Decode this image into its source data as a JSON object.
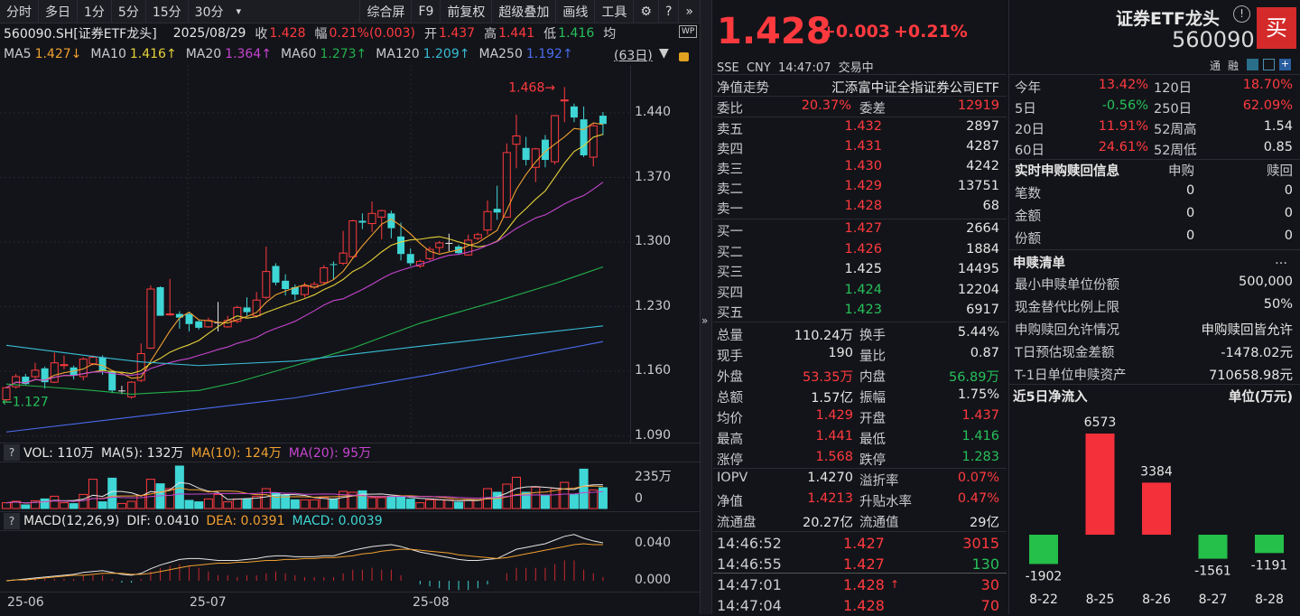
{
  "toolbar": {
    "items": [
      "分时",
      "多日",
      "1分",
      "5分",
      "15分",
      "30分"
    ],
    "more": "▾",
    "right_items": [
      "综合屏",
      "F9",
      "前复权",
      "超级叠加",
      "画线",
      "工具"
    ]
  },
  "info": {
    "code_name": "560090.SH[证券ETF龙头]",
    "date": "2025/08/29",
    "close_label": "收",
    "close": "1.428",
    "amp_label": "幅",
    "amp": "0.21%(0.003)",
    "open_label": "开",
    "open": "1.437",
    "high_label": "高",
    "high": "1.441",
    "low_label": "低",
    "low": "1.416",
    "avg_label": "均",
    "wp": "WP"
  },
  "ma": [
    {
      "label": "MA5",
      "value": "1.427↓",
      "color": "#f0a030"
    },
    {
      "label": "MA10",
      "value": "1.416↑",
      "color": "#e6d23a"
    },
    {
      "label": "MA20",
      "value": "1.364↑",
      "color": "#c545cf"
    },
    {
      "label": "MA60",
      "value": "1.273↑",
      "color": "#22b14c"
    },
    {
      "label": "MA120",
      "value": "1.209↑",
      "color": "#39bdd6"
    },
    {
      "label": "MA250",
      "value": "1.192↑",
      "color": "#4a6cf0"
    }
  ],
  "period": "(63日)",
  "colors": {
    "up": "#ff3a3f",
    "down": "#3fd6d6",
    "flat": "#e6e6e6",
    "bg": "#131419"
  },
  "chart_data": [
    {
      "type": "candlestick",
      "title": "",
      "ylim": [
        1.09,
        1.47
      ],
      "y_ticks": [
        "1.440",
        "1.370",
        "1.300",
        "1.230",
        "1.160",
        "1.090"
      ],
      "x_ticks": [
        "25-06",
        "25-07",
        "25-08"
      ],
      "high_mark": "1.468",
      "low_mark": "1.127",
      "ohlc": [
        [
          1.129,
          1.143,
          1.127,
          1.142
        ],
        [
          1.143,
          1.157,
          1.141,
          1.154
        ],
        [
          1.154,
          1.157,
          1.145,
          1.146
        ],
        [
          1.154,
          1.169,
          1.152,
          1.161
        ],
        [
          1.163,
          1.165,
          1.141,
          1.148
        ],
        [
          1.148,
          1.18,
          1.147,
          1.169
        ],
        [
          1.166,
          1.177,
          1.162,
          1.167
        ],
        [
          1.164,
          1.166,
          1.151,
          1.155
        ],
        [
          1.154,
          1.175,
          1.15,
          1.173
        ],
        [
          1.168,
          1.177,
          1.166,
          1.175
        ],
        [
          1.175,
          1.177,
          1.156,
          1.161
        ],
        [
          1.16,
          1.161,
          1.136,
          1.139
        ],
        [
          1.139,
          1.144,
          1.135,
          1.139
        ],
        [
          1.132,
          1.149,
          1.13,
          1.148
        ],
        [
          1.15,
          1.19,
          1.148,
          1.179
        ],
        [
          1.185,
          1.253,
          1.184,
          1.249
        ],
        [
          1.251,
          1.252,
          1.22,
          1.22
        ],
        [
          1.221,
          1.26,
          1.22,
          1.222
        ],
        [
          1.222,
          1.225,
          1.206,
          1.218
        ],
        [
          1.222,
          1.223,
          1.203,
          1.211
        ],
        [
          1.214,
          1.216,
          1.205,
          1.207
        ],
        [
          1.208,
          1.218,
          1.207,
          1.215
        ],
        [
          1.213,
          1.235,
          1.203,
          1.213
        ],
        [
          1.208,
          1.22,
          1.207,
          1.215
        ],
        [
          1.214,
          1.231,
          1.212,
          1.229
        ],
        [
          1.229,
          1.24,
          1.22,
          1.224
        ],
        [
          1.22,
          1.246,
          1.218,
          1.237
        ],
        [
          1.24,
          1.295,
          1.238,
          1.268
        ],
        [
          1.274,
          1.277,
          1.253,
          1.256
        ],
        [
          1.258,
          1.265,
          1.242,
          1.249
        ],
        [
          1.251,
          1.254,
          1.237,
          1.243
        ],
        [
          1.243,
          1.256,
          1.24,
          1.252
        ],
        [
          1.251,
          1.257,
          1.249,
          1.254
        ],
        [
          1.256,
          1.275,
          1.254,
          1.272
        ],
        [
          1.276,
          1.279,
          1.259,
          1.275
        ],
        [
          1.277,
          1.312,
          1.275,
          1.288
        ],
        [
          1.284,
          1.324,
          1.282,
          1.323
        ],
        [
          1.323,
          1.331,
          1.314,
          1.321
        ],
        [
          1.32,
          1.344,
          1.311,
          1.331
        ],
        [
          1.327,
          1.335,
          1.303,
          1.334
        ],
        [
          1.331,
          1.334,
          1.304,
          1.315
        ],
        [
          1.306,
          1.321,
          1.28,
          1.287
        ],
        [
          1.287,
          1.293,
          1.274,
          1.277
        ],
        [
          1.274,
          1.281,
          1.272,
          1.279
        ],
        [
          1.282,
          1.295,
          1.28,
          1.292
        ],
        [
          1.294,
          1.301,
          1.288,
          1.299
        ],
        [
          1.299,
          1.309,
          1.29,
          1.299
        ],
        [
          1.295,
          1.297,
          1.286,
          1.288
        ],
        [
          1.286,
          1.308,
          1.285,
          1.302
        ],
        [
          1.304,
          1.31,
          1.302,
          1.308
        ],
        [
          1.313,
          1.345,
          1.308,
          1.333
        ],
        [
          1.336,
          1.361,
          1.324,
          1.332
        ],
        [
          1.327,
          1.407,
          1.326,
          1.397
        ],
        [
          1.406,
          1.438,
          1.38,
          1.415
        ],
        [
          1.402,
          1.414,
          1.383,
          1.389
        ],
        [
          1.381,
          1.402,
          1.365,
          1.401
        ],
        [
          1.411,
          1.416,
          1.381,
          1.389
        ],
        [
          1.387,
          1.438,
          1.384,
          1.437
        ],
        [
          1.453,
          1.468,
          1.43,
          1.454
        ],
        [
          1.447,
          1.45,
          1.43,
          1.435
        ],
        [
          1.433,
          1.447,
          1.392,
          1.394
        ],
        [
          1.392,
          1.428,
          1.382,
          1.426
        ],
        [
          1.437,
          1.441,
          1.416,
          1.428
        ]
      ],
      "ma_long": {
        "MA60": [
          [
            1,
            1.146
          ],
          [
            5,
            1.143
          ],
          [
            10,
            1.139
          ],
          [
            14,
            1.135
          ],
          [
            21,
            1.139
          ],
          [
            25,
            1.148
          ],
          [
            31,
            1.166
          ],
          [
            37,
            1.185
          ],
          [
            44,
            1.212
          ],
          [
            52,
            1.236
          ],
          [
            58,
            1.255
          ],
          [
            63,
            1.273
          ]
        ],
        "MA120": [
          [
            1,
            1.188
          ],
          [
            10,
            1.176
          ],
          [
            15,
            1.17
          ],
          [
            21,
            1.166
          ],
          [
            31,
            1.171
          ],
          [
            44,
            1.187
          ],
          [
            63,
            1.209
          ]
        ],
        "MA250": [
          [
            1,
            1.094
          ],
          [
            31,
            1.131
          ],
          [
            45,
            1.156
          ],
          [
            63,
            1.192
          ]
        ]
      }
    },
    {
      "type": "bar",
      "name": "VOL",
      "ylim": [
        0,
        235
      ],
      "y_ticks": [
        "235万",
        "0"
      ],
      "values": [
        32,
        40,
        20,
        43,
        53,
        68,
        32,
        27,
        78,
        162,
        37,
        168,
        28,
        40,
        73,
        162,
        137,
        110,
        235,
        45,
        37,
        53,
        78,
        37,
        53,
        53,
        68,
        110,
        85,
        73,
        48,
        48,
        48,
        62,
        53,
        95,
        90,
        98,
        60,
        60,
        68,
        68,
        52,
        32,
        48,
        48,
        48,
        35,
        45,
        45,
        110,
        90,
        135,
        173,
        90,
        118,
        73,
        112,
        145,
        77,
        218,
        103,
        115
      ]
    },
    {
      "type": "bar",
      "name": "MACD",
      "y_ticks": [
        "0.040",
        "0.000"
      ],
      "dif": [
        0.0,
        0.001,
        0.002,
        0.003,
        0.004,
        0.005,
        0.006,
        0.007,
        0.009,
        0.01,
        0.011,
        0.009,
        0.007,
        0.006,
        0.008,
        0.013,
        0.017,
        0.02,
        0.023,
        0.024,
        0.024,
        0.023,
        0.022,
        0.022,
        0.022,
        0.023,
        0.024,
        0.026,
        0.027,
        0.027,
        0.026,
        0.026,
        0.026,
        0.027,
        0.027,
        0.03,
        0.033,
        0.035,
        0.037,
        0.038,
        0.039,
        0.037,
        0.034,
        0.031,
        0.029,
        0.027,
        0.025,
        0.023,
        0.022,
        0.022,
        0.023,
        0.024,
        0.029,
        0.034,
        0.036,
        0.038,
        0.04,
        0.044,
        0.048,
        0.05,
        0.046,
        0.043,
        0.041
      ],
      "dea": [
        0.0,
        0.001,
        0.001,
        0.002,
        0.003,
        0.004,
        0.005,
        0.006,
        0.006,
        0.007,
        0.008,
        0.008,
        0.008,
        0.007,
        0.007,
        0.008,
        0.01,
        0.012,
        0.014,
        0.016,
        0.017,
        0.018,
        0.019,
        0.019,
        0.02,
        0.02,
        0.021,
        0.022,
        0.022,
        0.023,
        0.023,
        0.024,
        0.024,
        0.025,
        0.025,
        0.026,
        0.027,
        0.029,
        0.03,
        0.032,
        0.033,
        0.034,
        0.034,
        0.033,
        0.032,
        0.031,
        0.03,
        0.028,
        0.027,
        0.026,
        0.025,
        0.024,
        0.025,
        0.027,
        0.029,
        0.031,
        0.033,
        0.035,
        0.037,
        0.039,
        0.04,
        0.039,
        0.039
      ]
    },
    {
      "type": "bar",
      "title": "近5日净流入",
      "unit": "单位(万元)",
      "categories": [
        "8-22",
        "8-25",
        "8-26",
        "8-27",
        "8-28"
      ],
      "values": [
        -1902,
        6573,
        3384,
        -1561,
        -1191
      ]
    }
  ],
  "vol_header": {
    "vol": "VOL: 110万",
    "ma5": "MA(5): 132万",
    "ma10": "MA(10): 124万",
    "ma20": "MA(20): 95万"
  },
  "macd_header": {
    "name": "MACD(12,26,9)",
    "dif": "DIF: 0.0410",
    "dea": "DEA: 0.0391",
    "macd": "MACD: 0.0039"
  },
  "quote": {
    "price": "1.428",
    "change": "+0.003",
    "pct": "+0.21%",
    "name": "证券ETF龙头",
    "code": "560090",
    "buy": "买",
    "meta": "SSE  CNY  14:47:07  交易中",
    "tags": [
      "通",
      "融"
    ]
  },
  "nav": {
    "label": "净值走势",
    "fund": "汇添富中证全指证券公司ETF"
  },
  "weibi": {
    "label": "委比",
    "value": "20.37%",
    "diff_label": "委差",
    "diff": "12919"
  },
  "asks": [
    {
      "l": "卖五",
      "p": "1.432",
      "v": "2897",
      "c": "red"
    },
    {
      "l": "卖四",
      "p": "1.431",
      "v": "4287",
      "c": "red"
    },
    {
      "l": "卖三",
      "p": "1.430",
      "v": "4242",
      "c": "red"
    },
    {
      "l": "卖二",
      "p": "1.429",
      "v": "13751",
      "c": "red"
    },
    {
      "l": "卖一",
      "p": "1.428",
      "v": "68",
      "c": "red"
    }
  ],
  "bids": [
    {
      "l": "买一",
      "p": "1.427",
      "v": "2664",
      "c": "red"
    },
    {
      "l": "买二",
      "p": "1.426",
      "v": "1884",
      "c": "red"
    },
    {
      "l": "买三",
      "p": "1.425",
      "v": "14495",
      "c": "wht"
    },
    {
      "l": "买四",
      "p": "1.424",
      "v": "12204",
      "c": "grn"
    },
    {
      "l": "买五",
      "p": "1.423",
      "v": "6917",
      "c": "grn"
    }
  ],
  "stats": [
    [
      "总量",
      "110.24万",
      "wht",
      "换手",
      "5.44%",
      "wht"
    ],
    [
      "现手",
      "190",
      "wht",
      "量比",
      "0.87",
      "wht"
    ],
    [
      "外盘",
      "53.35万",
      "red",
      "内盘",
      "56.89万",
      "grn"
    ],
    [
      "总额",
      "1.57亿",
      "wht",
      "振幅",
      "1.75%",
      "wht"
    ],
    [
      "均价",
      "1.429",
      "red",
      "开盘",
      "1.437",
      "red"
    ],
    [
      "最高",
      "1.441",
      "red",
      "最低",
      "1.416",
      "grn"
    ],
    [
      "涨停",
      "1.568",
      "red",
      "跌停",
      "1.283",
      "grn"
    ]
  ],
  "stats2": [
    [
      "IOPV",
      "1.4270",
      "wht",
      "溢折率",
      "0.07%",
      "red"
    ],
    [
      "净值",
      "1.4213",
      "red",
      "升贴水率",
      "0.47%",
      "red"
    ],
    [
      "流通盘",
      "20.27亿",
      "wht",
      "流通值",
      "29亿",
      "wht"
    ]
  ],
  "ticks": [
    [
      "14:46:52",
      "1.427",
      "3015",
      "red",
      ""
    ],
    [
      "14:46:55",
      "1.427",
      "130",
      "grn",
      ""
    ],
    [
      "14:47:01",
      "1.428",
      "30",
      "red",
      "↑"
    ],
    [
      "14:47:04",
      "1.428",
      "70",
      "red",
      ""
    ]
  ],
  "perf": [
    [
      "今年",
      "13.42%",
      "red",
      "120日",
      "18.70%",
      "red"
    ],
    [
      "5日",
      "-0.56%",
      "grn",
      "250日",
      "62.09%",
      "red"
    ],
    [
      "20日",
      "11.91%",
      "red",
      "52周高",
      "1.54",
      "wht"
    ],
    [
      "60日",
      "24.61%",
      "red",
      "52周低",
      "0.85",
      "wht"
    ]
  ],
  "creation": {
    "title": "实时申购赎回信息",
    "col1": "申购",
    "col2": "赎回",
    "rows": [
      [
        "笔数",
        "0",
        "0"
      ],
      [
        "金额",
        "0",
        "0"
      ],
      [
        "份额",
        "0",
        "0"
      ]
    ]
  },
  "list": {
    "title": "申赎清单",
    "more": "...",
    "rows": [
      [
        "最小申赎单位份额",
        "500,000"
      ],
      [
        "现金替代比例上限",
        "50%"
      ],
      [
        "申购赎回允许情况",
        "申购赎回皆允许"
      ],
      [
        "T日预估现金差额",
        "-1478.02元"
      ],
      [
        "T-1日单位申赎资产",
        "710658.98元"
      ]
    ]
  }
}
